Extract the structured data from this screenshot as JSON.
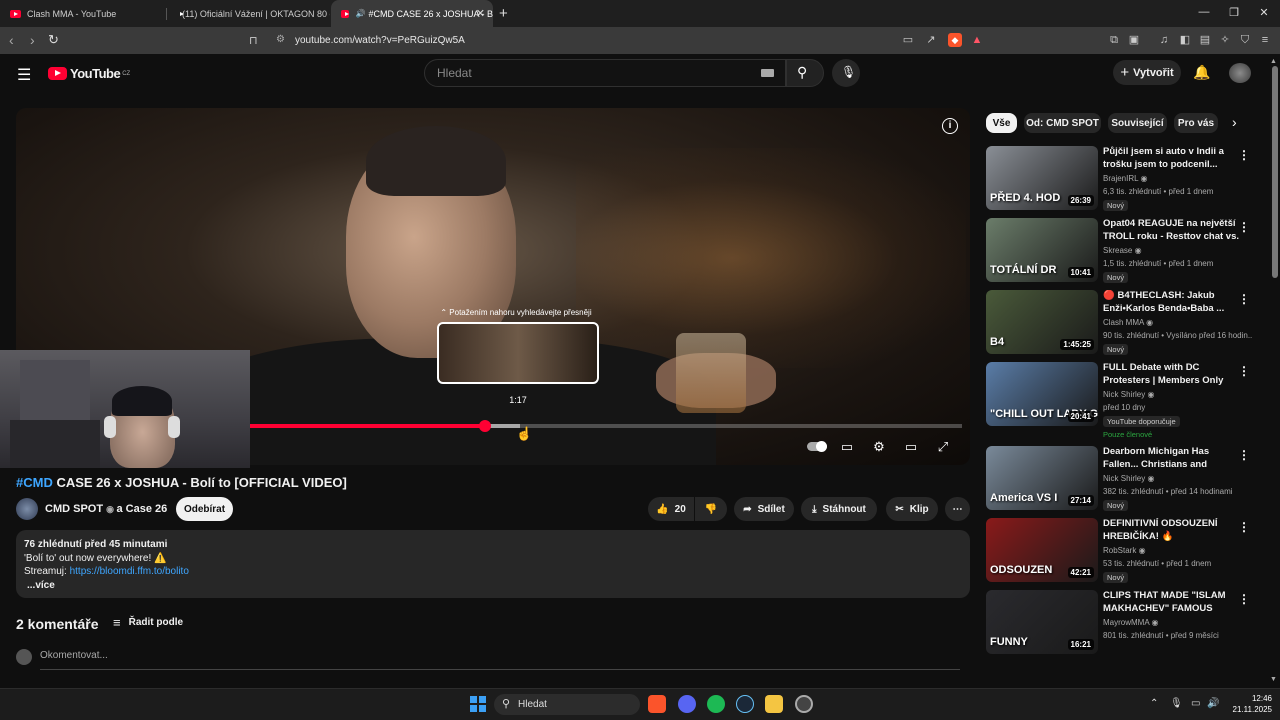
{
  "browser": {
    "tabs": [
      {
        "title": "Clash MMA - YouTube"
      },
      {
        "title": "(11) Oficiální Vážení | OKTAGON 80 c"
      },
      {
        "title": "#CMD CASE 26 x JOSHUA - B"
      }
    ],
    "url": "youtube.com/watch?v=PeRGuizQw5A"
  },
  "youtube": {
    "logo": "YouTube",
    "region": "CZ",
    "search_placeholder": "Hledat",
    "create_label": "Vytvořit"
  },
  "player": {
    "drag_hint": "⌃ Potažením nahoru vyhledávejte přesněji",
    "preview_time": "1:17",
    "progress_fraction": 0.33
  },
  "video": {
    "tag": "#CMD",
    "title_rest": " CASE 26 x JOSHUA - Bolí to [OFFICIAL VIDEO]",
    "channel": "CMD SPOT",
    "collab": "a Case 26",
    "subscribe_label": "Odebírat",
    "likes": "20",
    "share_label": "Sdílet",
    "download_label": "Stáhnout",
    "clip_label": "Klip",
    "description": {
      "stats": "76 zhlédnutí  před 45 minutami",
      "line1": "'Bolí to' out now everywhere! ⚠️",
      "stream_label": "Streamuj:",
      "stream_link": "https://bloomdi.ffm.to/bolito",
      "more": "...více"
    },
    "comments_header": "2 komentáře",
    "sort_label": "Řadit podle",
    "comment_placeholder": "Okomentovat..."
  },
  "sidebar": {
    "chips": [
      "Vše",
      "Od: CMD SPOT",
      "Související",
      "Pro vás"
    ],
    "recommendations": [
      {
        "title": "Půjčil jsem si auto v Indii a trošku jsem to podcenil... (Indi...",
        "channel": "BrajenIRL",
        "meta": "6,3 tis. zhlédnutí • před 1 dnem",
        "badge": "Nový",
        "duration": "26:39",
        "thumb_text": "PŘED  4. HOD",
        "color": "#8a8f96"
      },
      {
        "title": "Opat04 REAGUJE na největší TROLL roku - Resttov chat vs. ...",
        "channel": "Skrease",
        "meta": "1,5 tis. zhlédnutí • před 1 dnem",
        "badge": "Nový",
        "duration": "10:41",
        "thumb_text": "TOTÁLNÍ DR",
        "color": "#6b7d6a"
      },
      {
        "title": "🔴 B4THECLASH: Jakub Enži•Karlos Benda•Baba ...",
        "channel": "Clash MMA",
        "meta": "90 tis. zhlédnutí • Vysíláno před 16 hodin...",
        "badge": "Nový",
        "duration": "1:45:25",
        "thumb_text": "B4",
        "color": "#4a5a3a"
      },
      {
        "title": "FULL Debate with DC Protesters | Members Only",
        "channel": "Nick Shirley",
        "meta": "před 10 dny",
        "badge": "YouTube doporučuje",
        "badge2": "Pouze členové",
        "duration": "20:41",
        "thumb_text": "\"CHILL OUT LADY G",
        "color": "#5a7da8"
      },
      {
        "title": "Dearborn Michigan Has Fallen... Christians and Muslims Battle",
        "channel": "Nick Shirley",
        "meta": "382 tis. zhlédnutí • před 14 hodinami",
        "badge": "Nový",
        "duration": "27:14",
        "thumb_text": "America VS I",
        "color": "#7a8a9a"
      },
      {
        "title": "DEFINITIVNÍ ODSOUZENÍ HREBIČÍKA! 🔥",
        "channel": "RobStark",
        "meta": "53 tis. zhlédnutí • před 1 dnem",
        "badge": "Nový",
        "duration": "42:21",
        "thumb_text": "ODSOUZEN",
        "color": "#8a1a1a"
      },
      {
        "title": "CLIPS THAT MADE \"ISLAM MAKHACHEV\" FAMOUS",
        "channel": "MayrowMMA",
        "meta": "801 tis. zhlédnutí • před 9 měsíci",
        "badge": "",
        "duration": "16:21",
        "thumb_text": "FUNNY",
        "color": "#2a2a2e"
      }
    ]
  },
  "taskbar": {
    "search_label": "Hledat",
    "time": "12:46",
    "date": "21.11.2025"
  },
  "colors": {
    "accent": "#ff0033",
    "link": "#3ea6ff",
    "bg": "#0f0f0f"
  }
}
